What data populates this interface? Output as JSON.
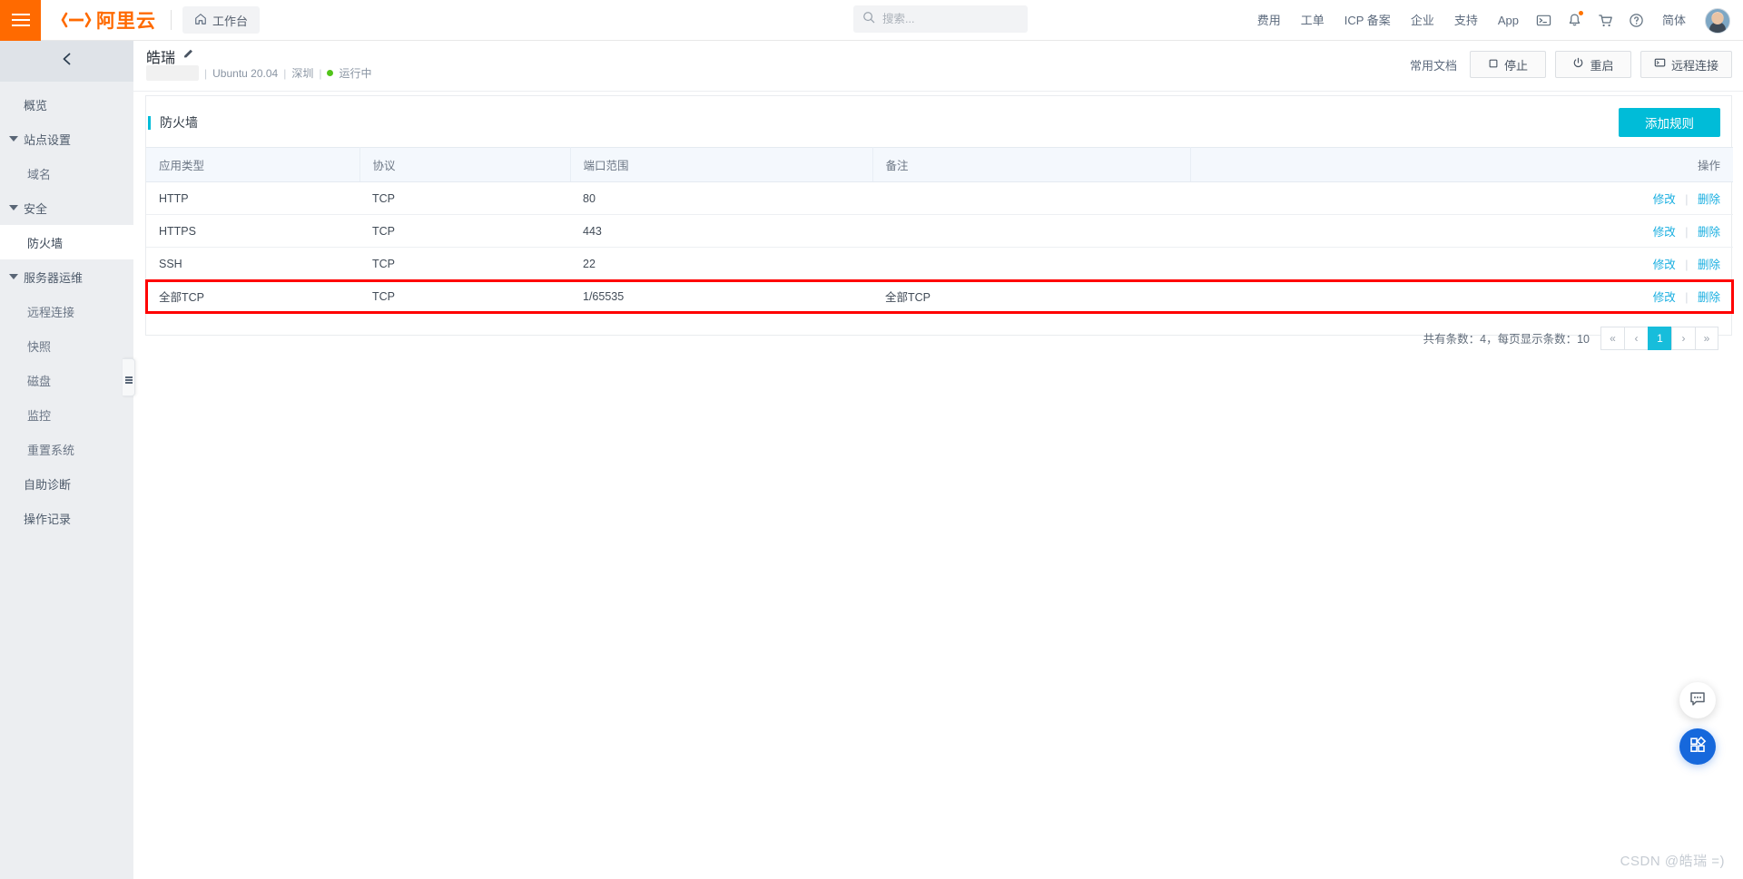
{
  "header": {
    "brand": "阿里云",
    "workbench": "工作台",
    "workbench_icon": "home-icon",
    "menu_icon": "hamburger-icon",
    "search": {
      "placeholder": "搜索...",
      "value": "",
      "icon": "search-icon"
    },
    "nav_links": [
      "费用",
      "工单",
      "ICP 备案",
      "企业",
      "支持",
      "App"
    ],
    "icons": [
      {
        "name": "terminal-icon",
        "glyph": "terminal"
      },
      {
        "name": "bell-icon",
        "glyph": "bell",
        "has_badge": true
      },
      {
        "name": "cart-icon",
        "glyph": "cart"
      },
      {
        "name": "help-icon",
        "glyph": "question"
      }
    ],
    "language": "简体",
    "avatar": "user-avatar"
  },
  "sidebar": {
    "collapse_icon": "chevron-left-icon",
    "items": [
      {
        "label": "概览",
        "type": "top",
        "active": false
      },
      {
        "label": "站点设置",
        "type": "group",
        "active": false
      },
      {
        "label": "域名",
        "type": "leaf",
        "active": false
      },
      {
        "label": "安全",
        "type": "group",
        "active": false
      },
      {
        "label": "防火墙",
        "type": "leaf",
        "active": true
      },
      {
        "label": "服务器运维",
        "type": "group",
        "active": false
      },
      {
        "label": "远程连接",
        "type": "leaf",
        "active": false
      },
      {
        "label": "快照",
        "type": "leaf",
        "active": false
      },
      {
        "label": "磁盘",
        "type": "leaf",
        "active": false
      },
      {
        "label": "监控",
        "type": "leaf",
        "active": false
      },
      {
        "label": "重置系统",
        "type": "leaf",
        "active": false
      },
      {
        "label": "自助诊断",
        "type": "top",
        "active": false
      },
      {
        "label": "操作记录",
        "type": "top",
        "active": false
      }
    ]
  },
  "instance": {
    "name": "皓瑞",
    "edit_icon": "pencil-icon",
    "os": "Ubuntu 20.04",
    "region": "深圳",
    "status": "运行中",
    "status_color": "#52c41a",
    "doc_link": "常用文档",
    "buttons": [
      {
        "label": "停止",
        "icon": "stop-icon"
      },
      {
        "label": "重启",
        "icon": "power-icon"
      },
      {
        "label": "远程连接",
        "icon": "monitor-icon"
      }
    ]
  },
  "panel": {
    "title": "防火墙",
    "accent_color": "#00bcd8",
    "add_button": "添加规则"
  },
  "table": {
    "columns": [
      "应用类型",
      "协议",
      "端口范围",
      "备注",
      "操作"
    ],
    "rows": [
      {
        "app": "HTTP",
        "protocol": "TCP",
        "port": "80",
        "note": "",
        "edit": "修改",
        "delete": "删除",
        "highlight": false
      },
      {
        "app": "HTTPS",
        "protocol": "TCP",
        "port": "443",
        "note": "",
        "edit": "修改",
        "delete": "删除",
        "highlight": false
      },
      {
        "app": "SSH",
        "protocol": "TCP",
        "port": "22",
        "note": "",
        "edit": "修改",
        "delete": "删除",
        "highlight": false
      },
      {
        "app": "全部TCP",
        "protocol": "TCP",
        "port": "1/65535",
        "note": "全部TCP",
        "edit": "修改",
        "delete": "删除",
        "highlight": true
      }
    ]
  },
  "pagination": {
    "info": "共有条数：4，每页显示条数：10",
    "first": "«",
    "prev": "‹",
    "current": "1",
    "next": "›",
    "last": "»"
  },
  "floating": {
    "chat": "chat-icon",
    "apps": "apps-grid-icon"
  },
  "watermark": "CSDN @皓瑞 =)"
}
